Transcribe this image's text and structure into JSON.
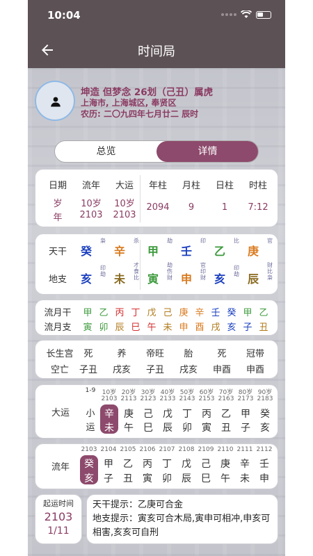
{
  "status": {
    "time": "10:04"
  },
  "nav": {
    "title": "时间局"
  },
  "profile": {
    "line1": "坤造 但梦念 26划（己丑）属虎",
    "line2": "上海市, 上海城区, 奉贤区",
    "line3": "农历: 二〇九四年七月廿二 辰时"
  },
  "tabs": {
    "overview": "总览",
    "detail": "详情"
  },
  "dates": {
    "headers": [
      "日期",
      "流年",
      "大运",
      "年柱",
      "月柱",
      "日柱",
      "时柱"
    ],
    "row1": [
      "岁",
      "10岁",
      "10岁"
    ],
    "row2": [
      "年",
      "2103",
      "2103"
    ],
    "values": [
      "2094",
      "9",
      "1",
      "7:12"
    ]
  },
  "pillars": {
    "tg_label": "天干",
    "dz_label": "地支",
    "tg": [
      {
        "ch": "癸",
        "color": "#1a3fbf",
        "note": "枭"
      },
      {
        "ch": "辛",
        "color": "#d97a1e",
        "note": "杀"
      },
      {
        "ch": "甲",
        "color": "#3c9a3c",
        "note": "劫"
      },
      {
        "ch": "壬",
        "color": "#1a3fbf",
        "note": "印"
      },
      {
        "ch": "乙",
        "color": "#3c9a3c",
        "note": "比"
      },
      {
        "ch": "庚",
        "color": "#d97a1e",
        "note": "官"
      }
    ],
    "dz": [
      {
        "ch": "亥",
        "color": "#1a3fbf",
        "note": "印劫"
      },
      {
        "ch": "未",
        "color": "#8a6a20",
        "note": "才食比"
      },
      {
        "ch": "寅",
        "color": "#3c9a3c",
        "note": "劫伤财"
      },
      {
        "ch": "申",
        "color": "#d97a1e",
        "note": "官印财"
      },
      {
        "ch": "亥",
        "color": "#1a3fbf",
        "note": "印劫"
      },
      {
        "ch": "辰",
        "color": "#8a6a20",
        "note": "财比枭"
      }
    ]
  },
  "liuyue": {
    "gan_label": "流月干",
    "zhi_label": "流月支",
    "gan": [
      {
        "ch": "甲",
        "color": "#3c9a3c"
      },
      {
        "ch": "乙",
        "color": "#3c9a3c"
      },
      {
        "ch": "丙",
        "color": "#d32f2f"
      },
      {
        "ch": "丁",
        "color": "#d32f2f"
      },
      {
        "ch": "戊",
        "color": "#b07a1a"
      },
      {
        "ch": "己",
        "color": "#b07a1a"
      },
      {
        "ch": "庚",
        "color": "#d97a1e"
      },
      {
        "ch": "辛",
        "color": "#d97a1e"
      },
      {
        "ch": "壬",
        "color": "#1a3fbf"
      },
      {
        "ch": "癸",
        "color": "#1a3fbf"
      },
      {
        "ch": "甲",
        "color": "#3c9a3c"
      },
      {
        "ch": "乙",
        "color": "#3c9a3c"
      }
    ],
    "zhi": [
      {
        "ch": "寅",
        "color": "#3c9a3c"
      },
      {
        "ch": "卯",
        "color": "#3c9a3c"
      },
      {
        "ch": "辰",
        "color": "#b07a1a"
      },
      {
        "ch": "巳",
        "color": "#d32f2f"
      },
      {
        "ch": "午",
        "color": "#d32f2f"
      },
      {
        "ch": "未",
        "color": "#b07a1a"
      },
      {
        "ch": "申",
        "color": "#d97a1e"
      },
      {
        "ch": "酉",
        "color": "#d97a1e"
      },
      {
        "ch": "戌",
        "color": "#b07a1a"
      },
      {
        "ch": "亥",
        "color": "#1a3fbf"
      },
      {
        "ch": "子",
        "color": "#1a3fbf"
      },
      {
        "ch": "丑",
        "color": "#b07a1a"
      }
    ]
  },
  "shensha": {
    "row1_label": "长生宫",
    "row2_label": "空亡",
    "row1": [
      "死",
      "养",
      "帝旺",
      "胎",
      "死",
      "冠带"
    ],
    "row2": [
      "子丑",
      "戌亥",
      "子丑",
      "戌亥",
      "申酉",
      "申酉"
    ]
  },
  "dayun": {
    "label": "大运",
    "first": [
      "1-9",
      "小",
      "运"
    ],
    "ages": [
      "10岁",
      "20岁",
      "30岁",
      "40岁",
      "50岁",
      "60岁",
      "70岁",
      "80岁",
      "90岁"
    ],
    "years": [
      "2103",
      "2113",
      "2123",
      "2133",
      "2143",
      "2153",
      "2163",
      "2173",
      "2183"
    ],
    "gan": [
      "辛",
      "庚",
      "己",
      "戊",
      "丁",
      "丙",
      "乙",
      "甲",
      "癸"
    ],
    "zhi": [
      "未",
      "午",
      "巳",
      "辰",
      "卯",
      "寅",
      "丑",
      "子",
      "亥"
    ]
  },
  "liunian": {
    "label": "流年",
    "years": [
      "2103",
      "2104",
      "2105",
      "2106",
      "2107",
      "2108",
      "2109",
      "2110",
      "2111",
      "2112"
    ],
    "gan": [
      "癸",
      "甲",
      "乙",
      "丙",
      "丁",
      "戊",
      "己",
      "庚",
      "辛",
      "壬"
    ],
    "zhi": [
      "亥",
      "子",
      "丑",
      "寅",
      "卯",
      "辰",
      "巳",
      "午",
      "未",
      "申"
    ]
  },
  "qiyun": {
    "label": "起运时间",
    "year": "2103",
    "date": "1/11"
  },
  "hints": {
    "tg": "天干提示：乙庚可合金",
    "dz": "地支提示：寅亥可合木局,寅申可相冲,申亥可相害,亥亥可自刑"
  },
  "accent": "#8d4a6c",
  "header_color": "#5c5155"
}
